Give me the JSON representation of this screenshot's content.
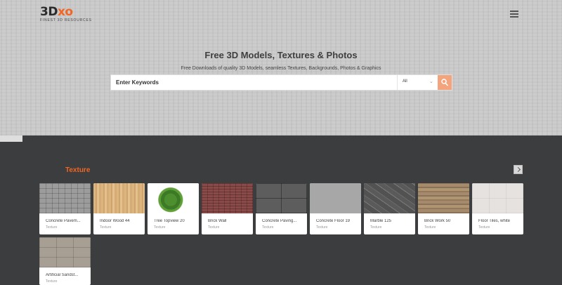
{
  "brand": {
    "logo_text_a": "3D",
    "logo_text_x": "x",
    "logo_text_b": "o",
    "tagline": "FINEST 3D RESOURCES"
  },
  "header": {
    "menu_icon": "hamburger-menu-icon"
  },
  "hero": {
    "title": "Free 3D Models, Textures & Photos",
    "subtitle": "Free Downloads of quality 3D Models, seamless Textures, Backgrounds, Photos & Graphics"
  },
  "search": {
    "placeholder": "Enter Keywords",
    "category": "All",
    "button_icon": "search-icon",
    "accent": "#f4a47c"
  },
  "section": {
    "title": "Texture",
    "accent": "#f26522",
    "next_icon": "chevron-right-icon"
  },
  "cards": [
    {
      "name": "Concrete Pavem...",
      "category": "Texture"
    },
    {
      "name": "Indoor Wood 44",
      "category": "Texture"
    },
    {
      "name": "Tree Topview 20",
      "category": "Texture"
    },
    {
      "name": "Brick Wall",
      "category": "Texture"
    },
    {
      "name": "Concrete Paving...",
      "category": "Texture"
    },
    {
      "name": "Concrete Floor 19",
      "category": "Texture"
    },
    {
      "name": "Marble 125",
      "category": "Texture"
    },
    {
      "name": "Brick Work 50",
      "category": "Texture"
    },
    {
      "name": "Floor Tiles, white",
      "category": "Texture"
    },
    {
      "name": "Artificial Sandst...",
      "category": "Texture"
    }
  ]
}
